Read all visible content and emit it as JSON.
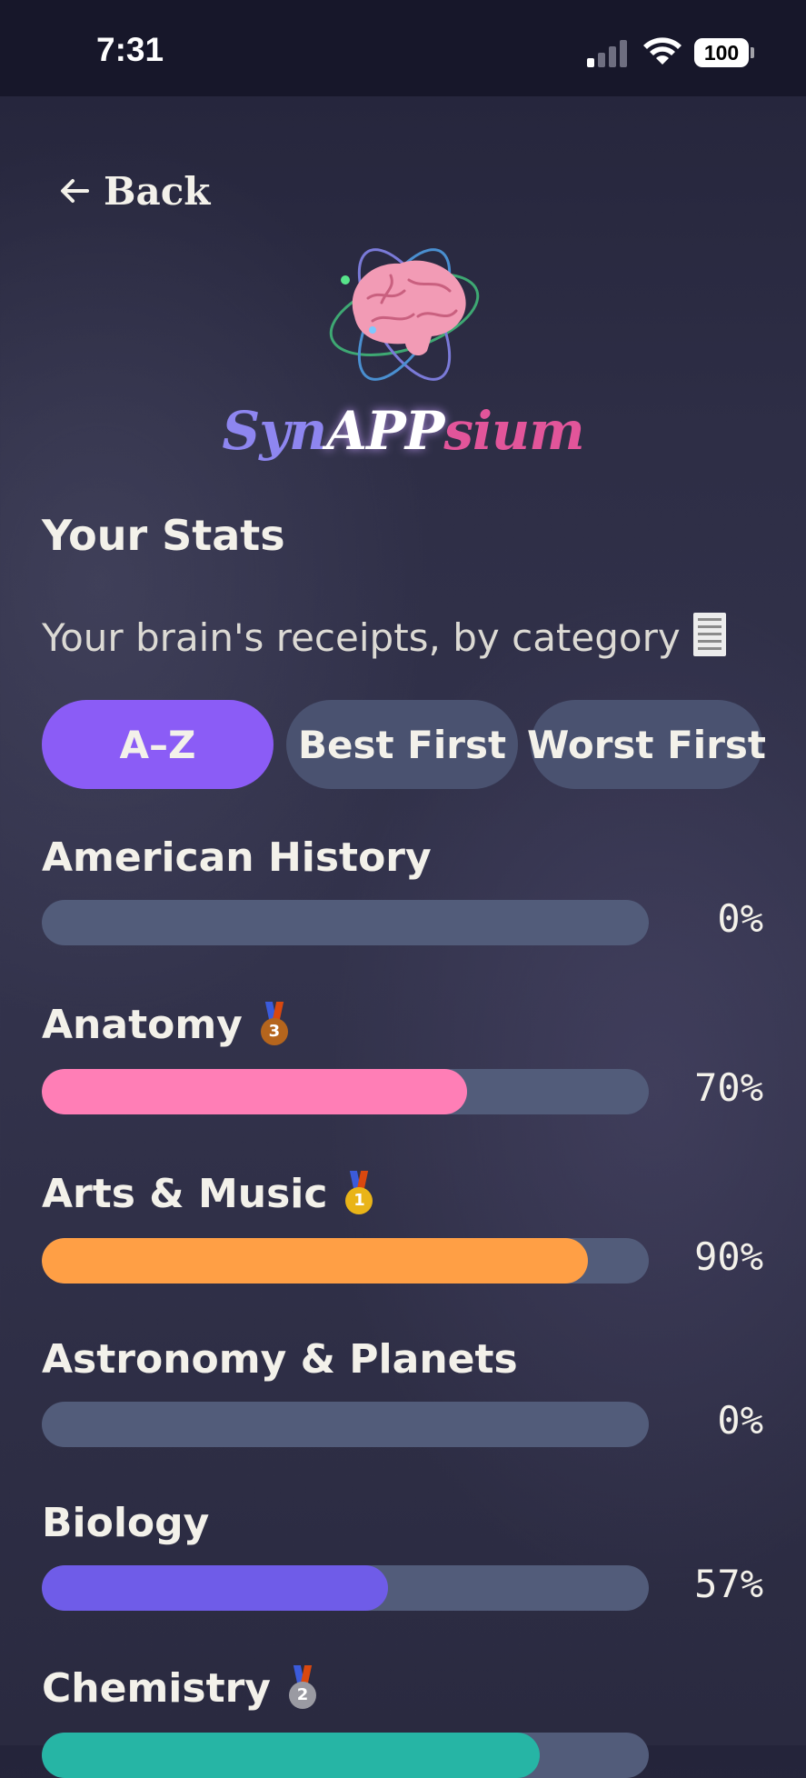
{
  "status_bar": {
    "time": "7:31",
    "battery": "100"
  },
  "nav": {
    "back_label": "Back"
  },
  "logo": {
    "part1": "Syn",
    "part2": "APP",
    "part3": "sium"
  },
  "header": {
    "title": "Your Stats",
    "subtitle": "Your brain's receipts, by category",
    "subtitle_icon": "receipt-icon"
  },
  "filters": [
    "A–Z",
    "Best First",
    "Worst First"
  ],
  "active_filter": "A–Z",
  "categories": [
    {
      "name": "American History",
      "percent": 0,
      "label": "0%",
      "color": "#525c7a",
      "medal": ""
    },
    {
      "name": "Anatomy",
      "percent": 70,
      "label": "70%",
      "color": "#ff7eb6",
      "medal": "bronze-medal-icon",
      "medal_rank": "3"
    },
    {
      "name": "Arts & Music",
      "percent": 90,
      "label": "90%",
      "color": "#ff9f45",
      "medal": "gold-medal-icon",
      "medal_rank": "1"
    },
    {
      "name": "Astronomy & Planets",
      "percent": 0,
      "label": "0%",
      "color": "#525c7a",
      "medal": ""
    },
    {
      "name": "Biology",
      "percent": 57,
      "label": "57%",
      "color": "#6f5ce8",
      "medal": ""
    },
    {
      "name": "Chemistry",
      "percent": 82,
      "label": "",
      "color": "#26b5a5",
      "medal": "silver-medal-icon",
      "medal_rank": "2"
    }
  ]
}
